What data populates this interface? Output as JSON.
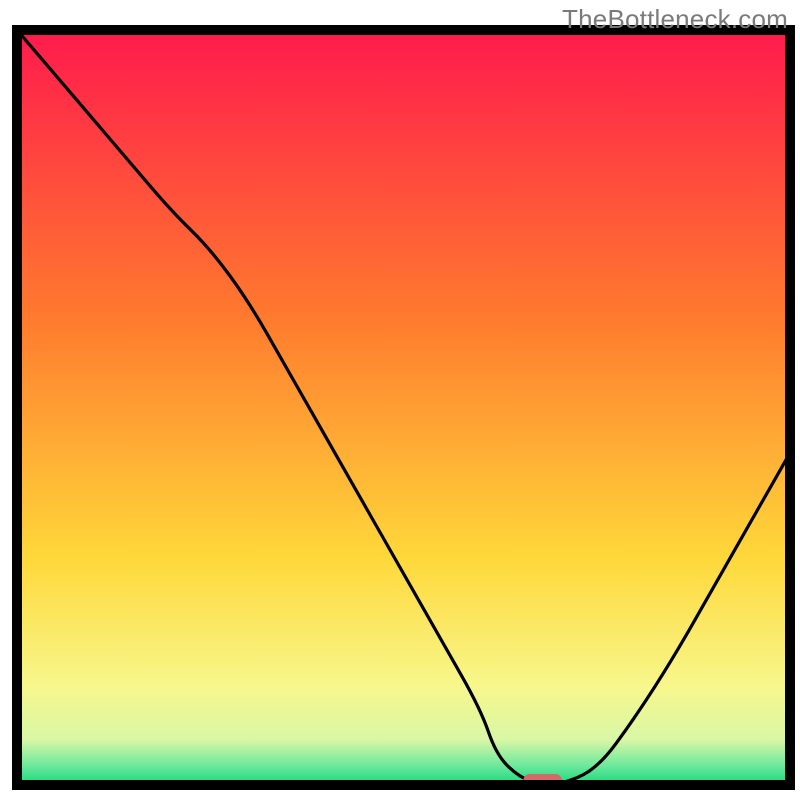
{
  "watermark": "TheBottleneck.com",
  "chart_data": {
    "type": "line",
    "title": "",
    "xlabel": "",
    "ylabel": "",
    "xlim": [
      0,
      100
    ],
    "ylim": [
      0,
      100
    ],
    "x": [
      0,
      5,
      10,
      15,
      20,
      25,
      30,
      35,
      40,
      45,
      50,
      55,
      60,
      62,
      65,
      68,
      70,
      75,
      80,
      85,
      90,
      95,
      100
    ],
    "values": [
      100,
      94,
      88,
      82,
      76,
      71,
      64,
      55,
      46,
      37,
      28,
      19,
      10,
      4,
      1,
      0,
      0,
      2,
      9,
      17,
      26,
      35,
      44
    ],
    "optimum_marker": {
      "x_start": 65.5,
      "x_end": 70.5,
      "y": 0.6
    },
    "background_gradient_stops": [
      {
        "offset": 0.0,
        "color": "#ff1a4d"
      },
      {
        "offset": 0.38,
        "color": "#ff7a2e"
      },
      {
        "offset": 0.7,
        "color": "#ffd83a"
      },
      {
        "offset": 0.87,
        "color": "#f7f78c"
      },
      {
        "offset": 0.94,
        "color": "#d9f7a6"
      },
      {
        "offset": 0.975,
        "color": "#6be89c"
      },
      {
        "offset": 1.0,
        "color": "#17d87a"
      }
    ],
    "curve_color": "#000000",
    "marker_color": "#d36a6a",
    "frame_color": "#000000"
  }
}
